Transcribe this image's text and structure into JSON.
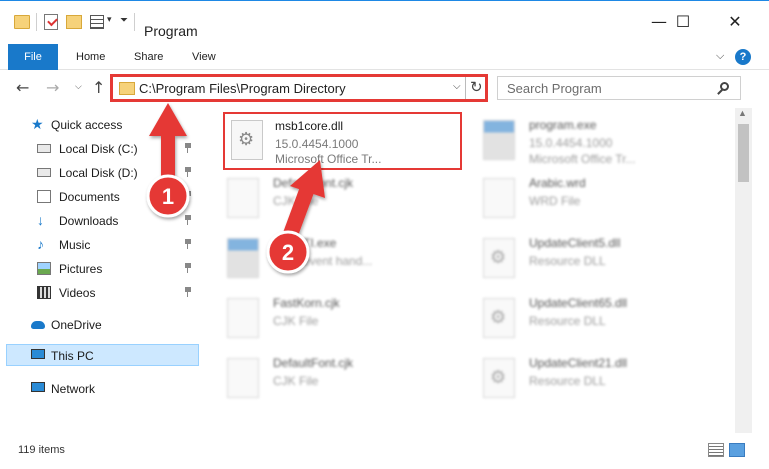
{
  "window": {
    "title": "Program",
    "controls": {
      "minimize": "—",
      "maximize": "☐",
      "close": "✕"
    }
  },
  "ribbon": {
    "tabs": [
      "File",
      "Home",
      "Share",
      "View"
    ],
    "help": "?"
  },
  "address": {
    "path": "C:\\Program Files\\Program Directory",
    "dropdown": "⌵",
    "refresh": "↻"
  },
  "search": {
    "placeholder": "Search Program"
  },
  "nav": {
    "back": "←",
    "forward": "→",
    "recent": "⌵",
    "up": "↑"
  },
  "sidebar": {
    "quick_access": "Quick access",
    "items": [
      {
        "label": "Local Disk (C:)",
        "icon": "drive-icon",
        "pinned": true
      },
      {
        "label": "Local Disk (D:)",
        "icon": "drive-icon",
        "pinned": true
      },
      {
        "label": "Documents",
        "icon": "documents-icon",
        "pinned": true
      },
      {
        "label": "Downloads",
        "icon": "downloads-icon",
        "pinned": true
      },
      {
        "label": "Music",
        "icon": "music-icon",
        "pinned": true
      },
      {
        "label": "Pictures",
        "icon": "pictures-icon",
        "pinned": true
      },
      {
        "label": "Videos",
        "icon": "videos-icon",
        "pinned": true
      }
    ],
    "onedrive": "OneDrive",
    "this_pc": "This PC",
    "network": "Network"
  },
  "files": [
    {
      "name": "msb1core.dll",
      "line2": "15.0.4454.1000",
      "line3": "Microsoft Office Tr...",
      "icon": "gear",
      "highlighted": true
    },
    {
      "name": "program.exe",
      "line2": "15.0.4454.1000",
      "line3": "Microsoft Office Tr...",
      "icon": "app"
    },
    {
      "name": "DefaultFont.cjk",
      "line2": "CJK File",
      "line3": "",
      "icon": "blank"
    },
    {
      "name": "Arabic.wrd",
      "line2": "WRD File",
      "line3": "",
      "icon": "blank"
    },
    {
      "name": "...yySTI.exe",
      "line2": "...r di event hand...",
      "line3": "",
      "icon": "app"
    },
    {
      "name": "UpdateClient5.dll",
      "line2": "Resource DLL",
      "line3": "",
      "icon": "gear"
    },
    {
      "name": "FastKorn.cjk",
      "line2": "CJK File",
      "line3": "",
      "icon": "blank"
    },
    {
      "name": "UpdateClient65.dll",
      "line2": "Resource DLL",
      "line3": "",
      "icon": "gear"
    },
    {
      "name": "DefaultFont.cjk",
      "line2": "CJK File",
      "line3": "",
      "icon": "blank"
    },
    {
      "name": "UpdateClient21.dll",
      "line2": "Resource DLL",
      "line3": "",
      "icon": "gear"
    }
  ],
  "status": {
    "count": "119 items"
  },
  "annotations": {
    "marker1": "1",
    "marker2": "2"
  },
  "colors": {
    "accent": "#1979ca",
    "highlight": "#e53935",
    "selected": "#cde8ff"
  }
}
